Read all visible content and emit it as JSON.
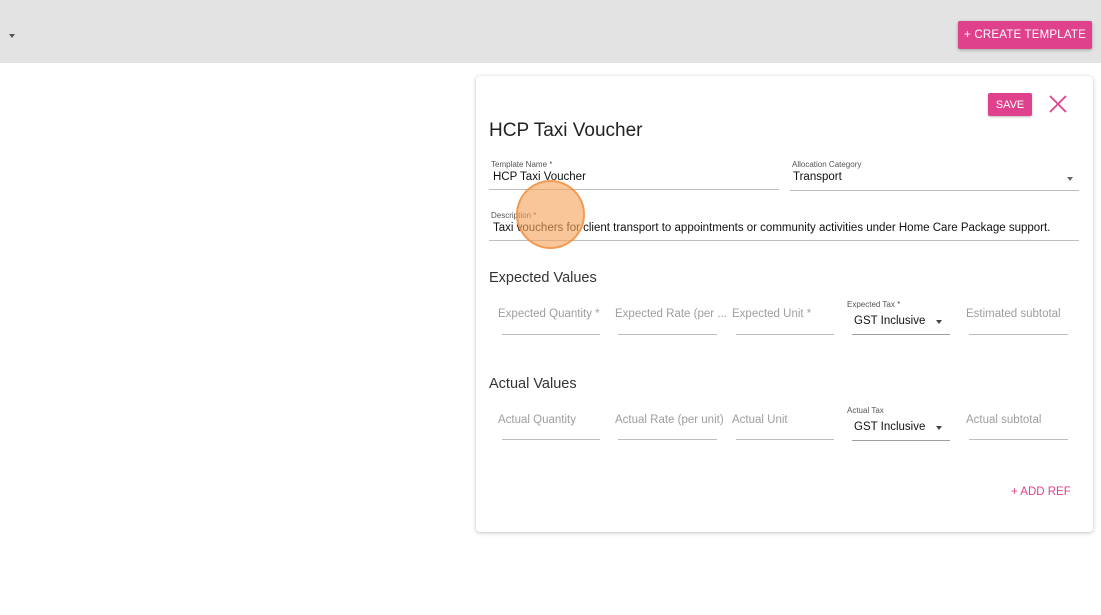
{
  "topbar": {
    "create_template_label": "+ CREATE TEMPLATE"
  },
  "form": {
    "save_label": "SAVE",
    "title": "HCP Taxi Voucher",
    "template_name": {
      "label": "Template Name *",
      "value": "HCP Taxi Voucher"
    },
    "allocation_category": {
      "label": "Allocation Category",
      "value": "Transport"
    },
    "description": {
      "label": "Description *",
      "value": "Taxi vouchers for client transport to appointments or community activities under Home Care Package support."
    },
    "expected": {
      "heading": "Expected Values",
      "quantity_placeholder": "Expected Quantity *",
      "rate_placeholder": "Expected Rate (per ...",
      "unit_placeholder": "Expected Unit *",
      "tax_label": "Expected Tax *",
      "tax_value": "GST Inclusive",
      "subtotal_placeholder": "Estimated subtotal"
    },
    "actual": {
      "heading": "Actual Values",
      "quantity_placeholder": "Actual Quantity",
      "rate_placeholder": "Actual Rate (per unit)",
      "unit_placeholder": "Actual Unit",
      "tax_label": "Actual Tax",
      "tax_value": "GST Inclusive",
      "subtotal_placeholder": "Actual subtotal"
    },
    "add_ref_label": "+ ADD REF"
  },
  "colors": {
    "accent": "#e0418d",
    "topbar": "#e3e3e3",
    "cursor_highlight": "#f6a35c"
  }
}
